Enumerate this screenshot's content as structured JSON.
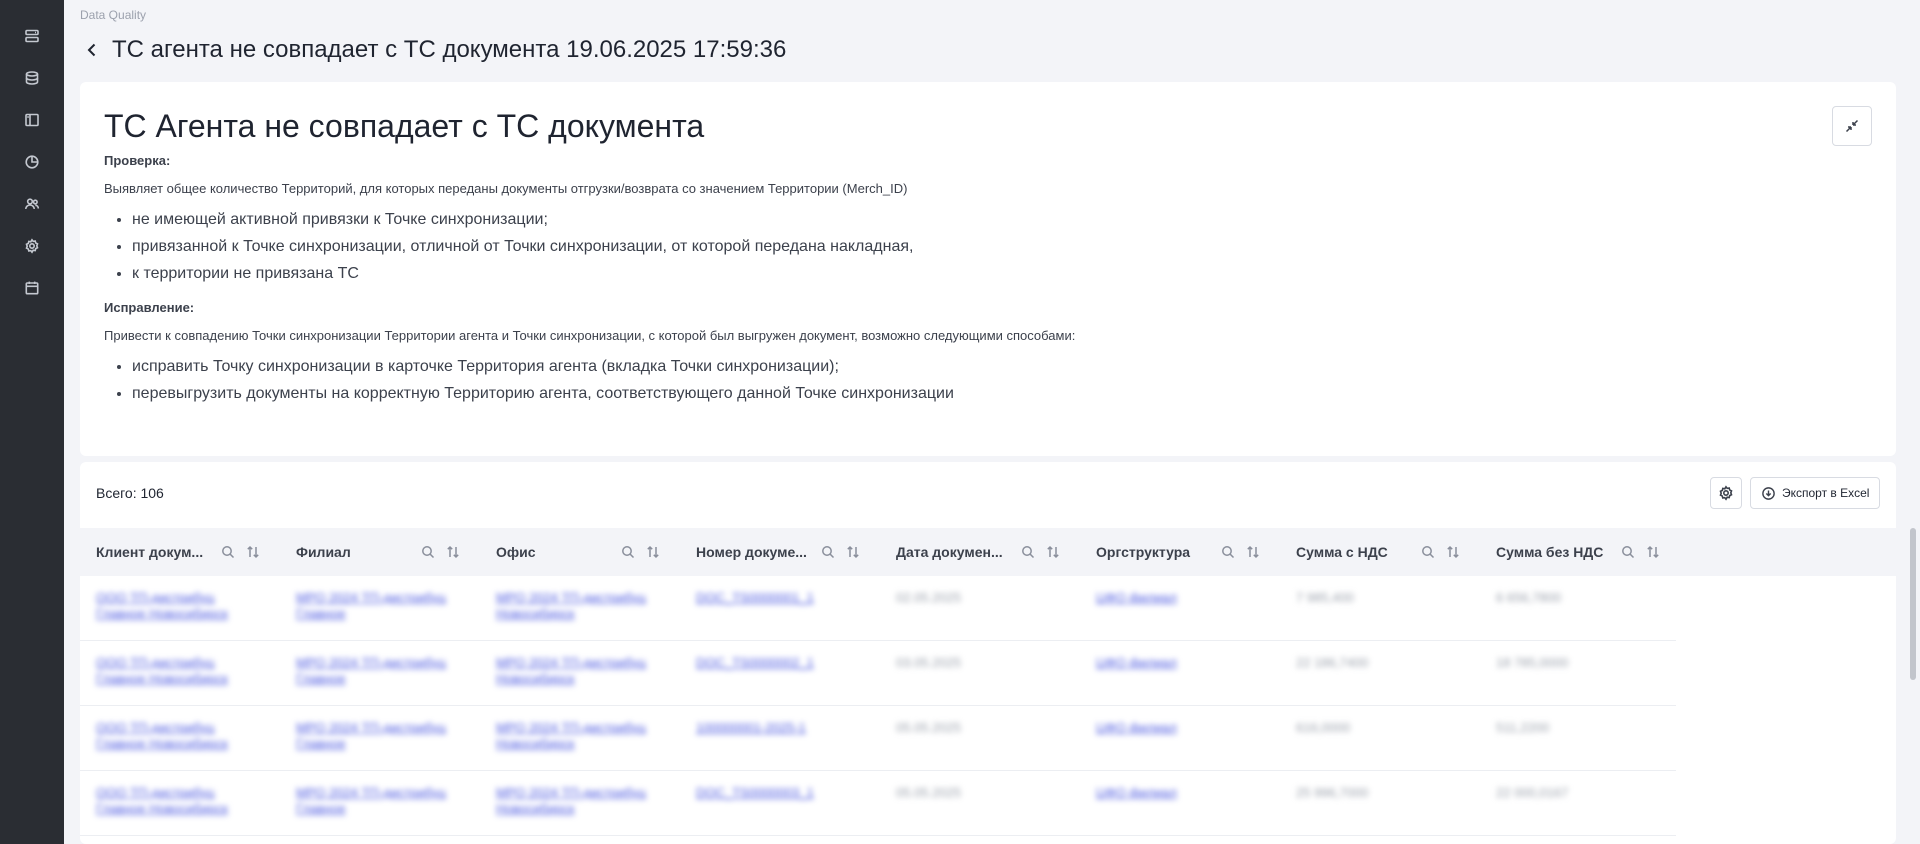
{
  "sidebar": {
    "items": [
      {
        "icon": "list-icon"
      },
      {
        "icon": "database-icon"
      },
      {
        "icon": "layout-icon"
      },
      {
        "icon": "pie-chart-icon"
      },
      {
        "icon": "users-icon"
      },
      {
        "icon": "gear-icon"
      },
      {
        "icon": "calendar-icon"
      }
    ]
  },
  "breadcrumb": "Data Quality",
  "page_title": "ТС агента не совпадает с ТС документа 19.06.2025 17:59:36",
  "description": {
    "title": "ТС Агента не совпадает с ТС документа",
    "check_label": "Проверка:",
    "check_text": "Выявляет общее количество Территорий, для которых переданы документы отгрузки/возврата со значением Территории (Merch_ID)",
    "check_items": [
      "не имеющей активной привязки к Точке синхронизации;",
      "привязанной к Точке синхронизации, отличной от Точки синхронизации, от которой передана накладная,",
      "к территории не привязана ТС"
    ],
    "fix_label": "Исправление:",
    "fix_text": "Привести к совпадению Точки синхронизации Территории агента и Точки синхронизации, с которой был выгружен документ, возможно следующими способами:",
    "fix_items": [
      "исправить Точку синхронизации в карточке Территория агента (вкладка Точки синхронизации);",
      "перевыгрузить документы на корректную Территорию агента, соответствующего данной Точке синхронизации"
    ]
  },
  "table": {
    "total": "Всего: 106",
    "export_label": "Экспорт в Excel",
    "columns": [
      "Клиент докум...",
      "Филиал",
      "Офис",
      "Номер докуме...",
      "Дата докумен...",
      "Оргструктура",
      "Сумма с НДС",
      "Сумма без НДС"
    ],
    "rows": [
      [
        "ООО ТП-дистрибуц Главное Новосибирск",
        "МРО 2024 ТП-дистрибуц Главное",
        "МРО 2024 ТП-дистрибуц Новосибирск",
        "DOC_TS0000001_1",
        "02.05.2025",
        "ЦФО филиал",
        "7 985,400",
        "6 656,7800"
      ],
      [
        "ООО ТП-дистрибуц Главное Новосибирск",
        "МРО 2024 ТП-дистрибуц Главное",
        "МРО 2024 ТП-дистрибуц Новосибирск",
        "DOC_TS0000002_1",
        "03.05.2025",
        "ЦФО филиал",
        "22 186,7400",
        "18 785,0000"
      ],
      [
        "ООО ТП-дистрибуц Главное Новосибирск",
        "МРО 2024 ТП-дистрибуц Главное",
        "МРО 2024 ТП-дистрибуц Новосибирск",
        "100000001-2025-1",
        "05.05.2025",
        "ЦФО филиал",
        "616,0000",
        "511,2200"
      ],
      [
        "ООО ТП-дистрибуц Главное Новосибирск",
        "МРО 2024 ТП-дистрибуц Главное",
        "МРО 2024 ТП-дистрибуц Новосибирск",
        "DOC_TS0000003_1",
        "05.05.2025",
        "ЦФО филиал",
        "25 996,7000",
        "22 000,0167"
      ]
    ]
  },
  "colors": {
    "sidebar_bg": "#2a2d33",
    "link": "#4a57e0",
    "page_bg": "#f3f4f8"
  }
}
